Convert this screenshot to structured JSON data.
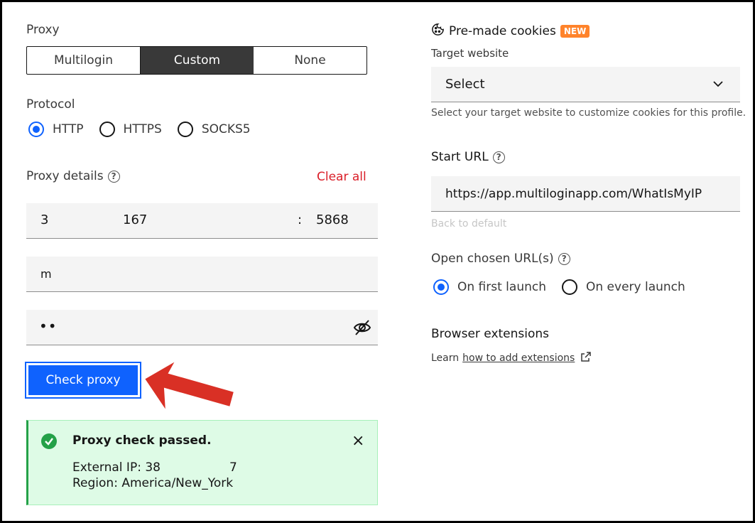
{
  "proxy": {
    "label": "Proxy",
    "tabs": [
      "Multilogin",
      "Custom",
      "None"
    ],
    "active_tab": "Custom"
  },
  "protocol": {
    "label": "Protocol",
    "options": [
      "HTTP",
      "HTTPS",
      "SOCKS5"
    ],
    "selected": "HTTP"
  },
  "details": {
    "label": "Proxy details",
    "clear_all": "Clear all",
    "host_prefix": "3",
    "host_suffix": "167",
    "colon": ":",
    "port": "5868",
    "username": "m",
    "password": "••"
  },
  "check_button": "Check proxy",
  "notice": {
    "title": "Proxy check passed.",
    "ip_label": "External IP: 38",
    "ip_suffix": "7",
    "region": "Region: America/New_York",
    "close": "×"
  },
  "cookies": {
    "title": "Pre-made cookies",
    "badge": "NEW",
    "target_label": "Target website",
    "select_value": "Select",
    "helper": "Select your target website to customize cookies for this profile."
  },
  "start_url": {
    "label": "Start URL",
    "value": "https://app.multiloginapp.com/WhatIsMyIP",
    "back_default": "Back to default"
  },
  "open_urls": {
    "label": "Open chosen URL(s)",
    "options": [
      "On first launch",
      "On every launch"
    ],
    "selected": "On first launch"
  },
  "extensions": {
    "title": "Browser extensions",
    "learn": "Learn",
    "link": "how to add extensions"
  },
  "colors": {
    "primary": "#0f62fe",
    "danger": "#da1e28",
    "success": "#24a148",
    "arrow": "#d93025",
    "badge": "#ff832b"
  }
}
